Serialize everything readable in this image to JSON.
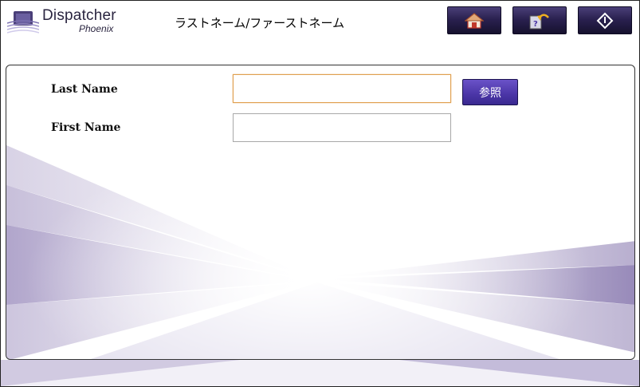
{
  "app": {
    "name": "Dispatcher",
    "subtitle": "Phoenix"
  },
  "header": {
    "title": "ラストネーム/ファーストネーム",
    "buttons": [
      {
        "icon": "home-icon"
      },
      {
        "icon": "help-back-icon"
      },
      {
        "icon": "start-icon"
      }
    ]
  },
  "form": {
    "last_name": {
      "label": "Last Name",
      "value": "",
      "browse_label": "参照"
    },
    "first_name": {
      "label": "First Name",
      "value": ""
    }
  },
  "colors": {
    "accent": "#4a35a6",
    "header_button": "#2a2150",
    "focus_border": "#e0a050"
  }
}
